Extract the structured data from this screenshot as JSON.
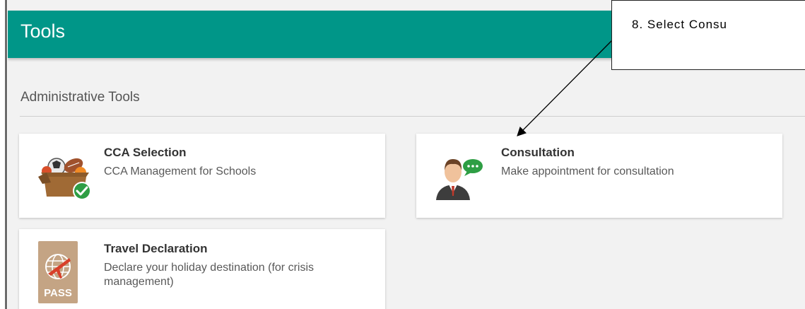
{
  "header": {
    "title": "Tools"
  },
  "section": {
    "title": "Administrative Tools"
  },
  "cards": [
    {
      "title": "CCA Selection",
      "description": "CCA Management for Schools",
      "icon": "cca-box-icon"
    },
    {
      "title": "Consultation",
      "description": "Make appointment for consultation",
      "icon": "consultant-icon"
    },
    {
      "title": "Travel Declaration",
      "description_line1": "Declare your holiday destination (for crisis",
      "description_line2": "management)",
      "icon": "passport-icon",
      "icon_text": "PASS"
    }
  ],
  "callout": {
    "text": "8.   Select  Consu"
  },
  "colors": {
    "header": "#009688",
    "background": "#f2f2f2",
    "card": "#ffffff"
  }
}
